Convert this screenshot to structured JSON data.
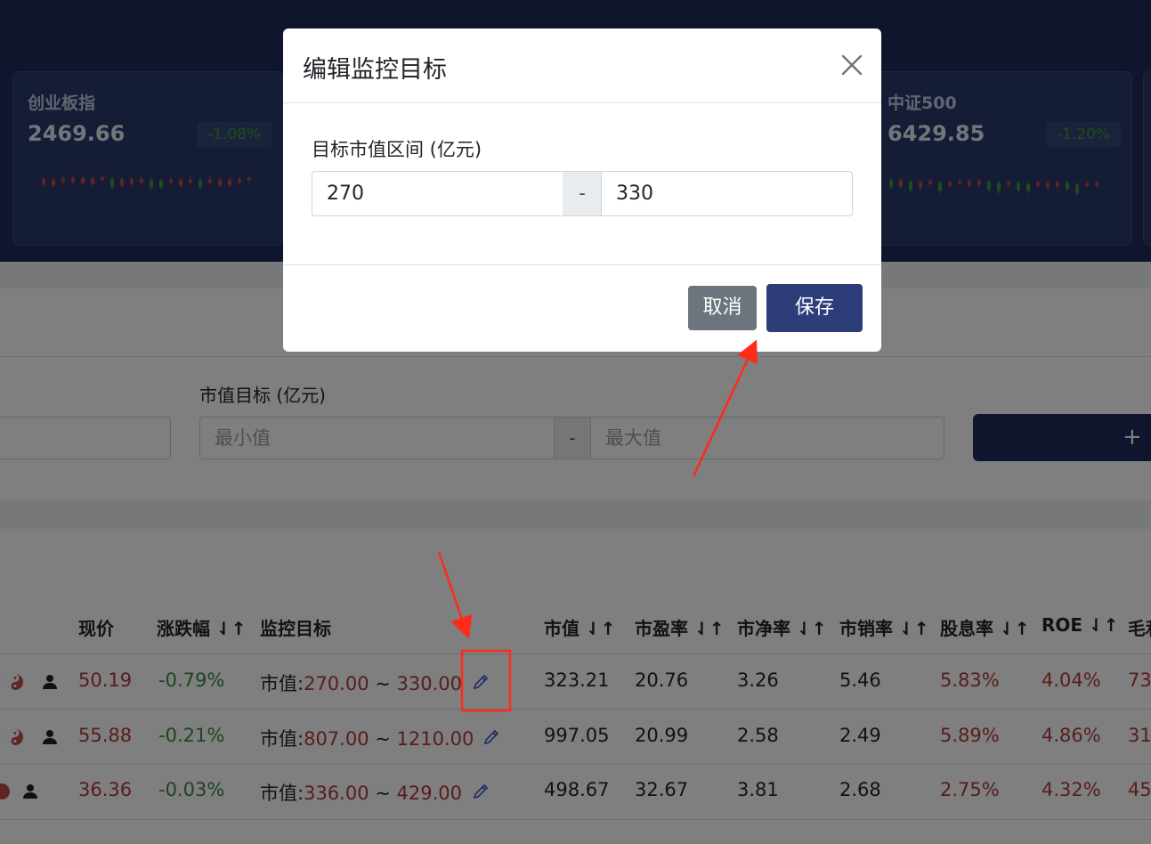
{
  "index_cards": [
    {
      "name": "创业板指",
      "value": "2469.66",
      "change": "-1.08%"
    },
    {
      "name": "中证500",
      "value": "6429.85",
      "change": "-1.20%"
    }
  ],
  "filter": {
    "market_cap_label": "市值目标 (亿元)",
    "min_placeholder": "最小值",
    "max_placeholder": "最大值",
    "separator": "-",
    "add_button_icon": "+"
  },
  "table": {
    "headers": {
      "price": "现价",
      "change": "涨跌幅 ⇃↑",
      "target": "监控目标",
      "mcap": "市值 ⇃↑",
      "pe": "市盈率 ⇃↑",
      "pb": "市净率 ⇃↑",
      "ps": "市销率 ⇃↑",
      "dividend": "股息率 ⇃↑",
      "roe": "ROE ⇃↑",
      "gross": "毛利"
    },
    "target_prefix": "市值:",
    "target_sep": "~",
    "rows": [
      {
        "price": "50.19",
        "change": "-0.79%",
        "tmin": "270.00",
        "tmax": "330.00",
        "mcap": "323.21",
        "pe": "20.76",
        "pb": "3.26",
        "ps": "5.46",
        "dividend": "5.83%",
        "roe": "4.04%",
        "gross": "73"
      },
      {
        "price": "55.88",
        "change": "-0.21%",
        "tmin": "807.00",
        "tmax": "1210.00",
        "mcap": "997.05",
        "pe": "20.99",
        "pb": "2.58",
        "ps": "2.49",
        "dividend": "5.89%",
        "roe": "4.86%",
        "gross": "31"
      },
      {
        "price": "36.36",
        "change": "-0.03%",
        "tmin": "336.00",
        "tmax": "429.00",
        "mcap": "498.67",
        "pe": "32.67",
        "pb": "3.81",
        "ps": "2.68",
        "dividend": "2.75%",
        "roe": "4.32%",
        "gross": "45"
      }
    ]
  },
  "modal": {
    "title": "编辑监控目标",
    "field_label": "目标市值区间 (亿元)",
    "min_value": "270",
    "max_value": "330",
    "separator": "-",
    "cancel_label": "取消",
    "save_label": "保存"
  },
  "colors": {
    "header_bg": "#1f2b5a",
    "primary": "#2c3d7a",
    "annotation": "#ff2a1a",
    "up": "#b03a3a",
    "down": "#3b8a3b"
  }
}
